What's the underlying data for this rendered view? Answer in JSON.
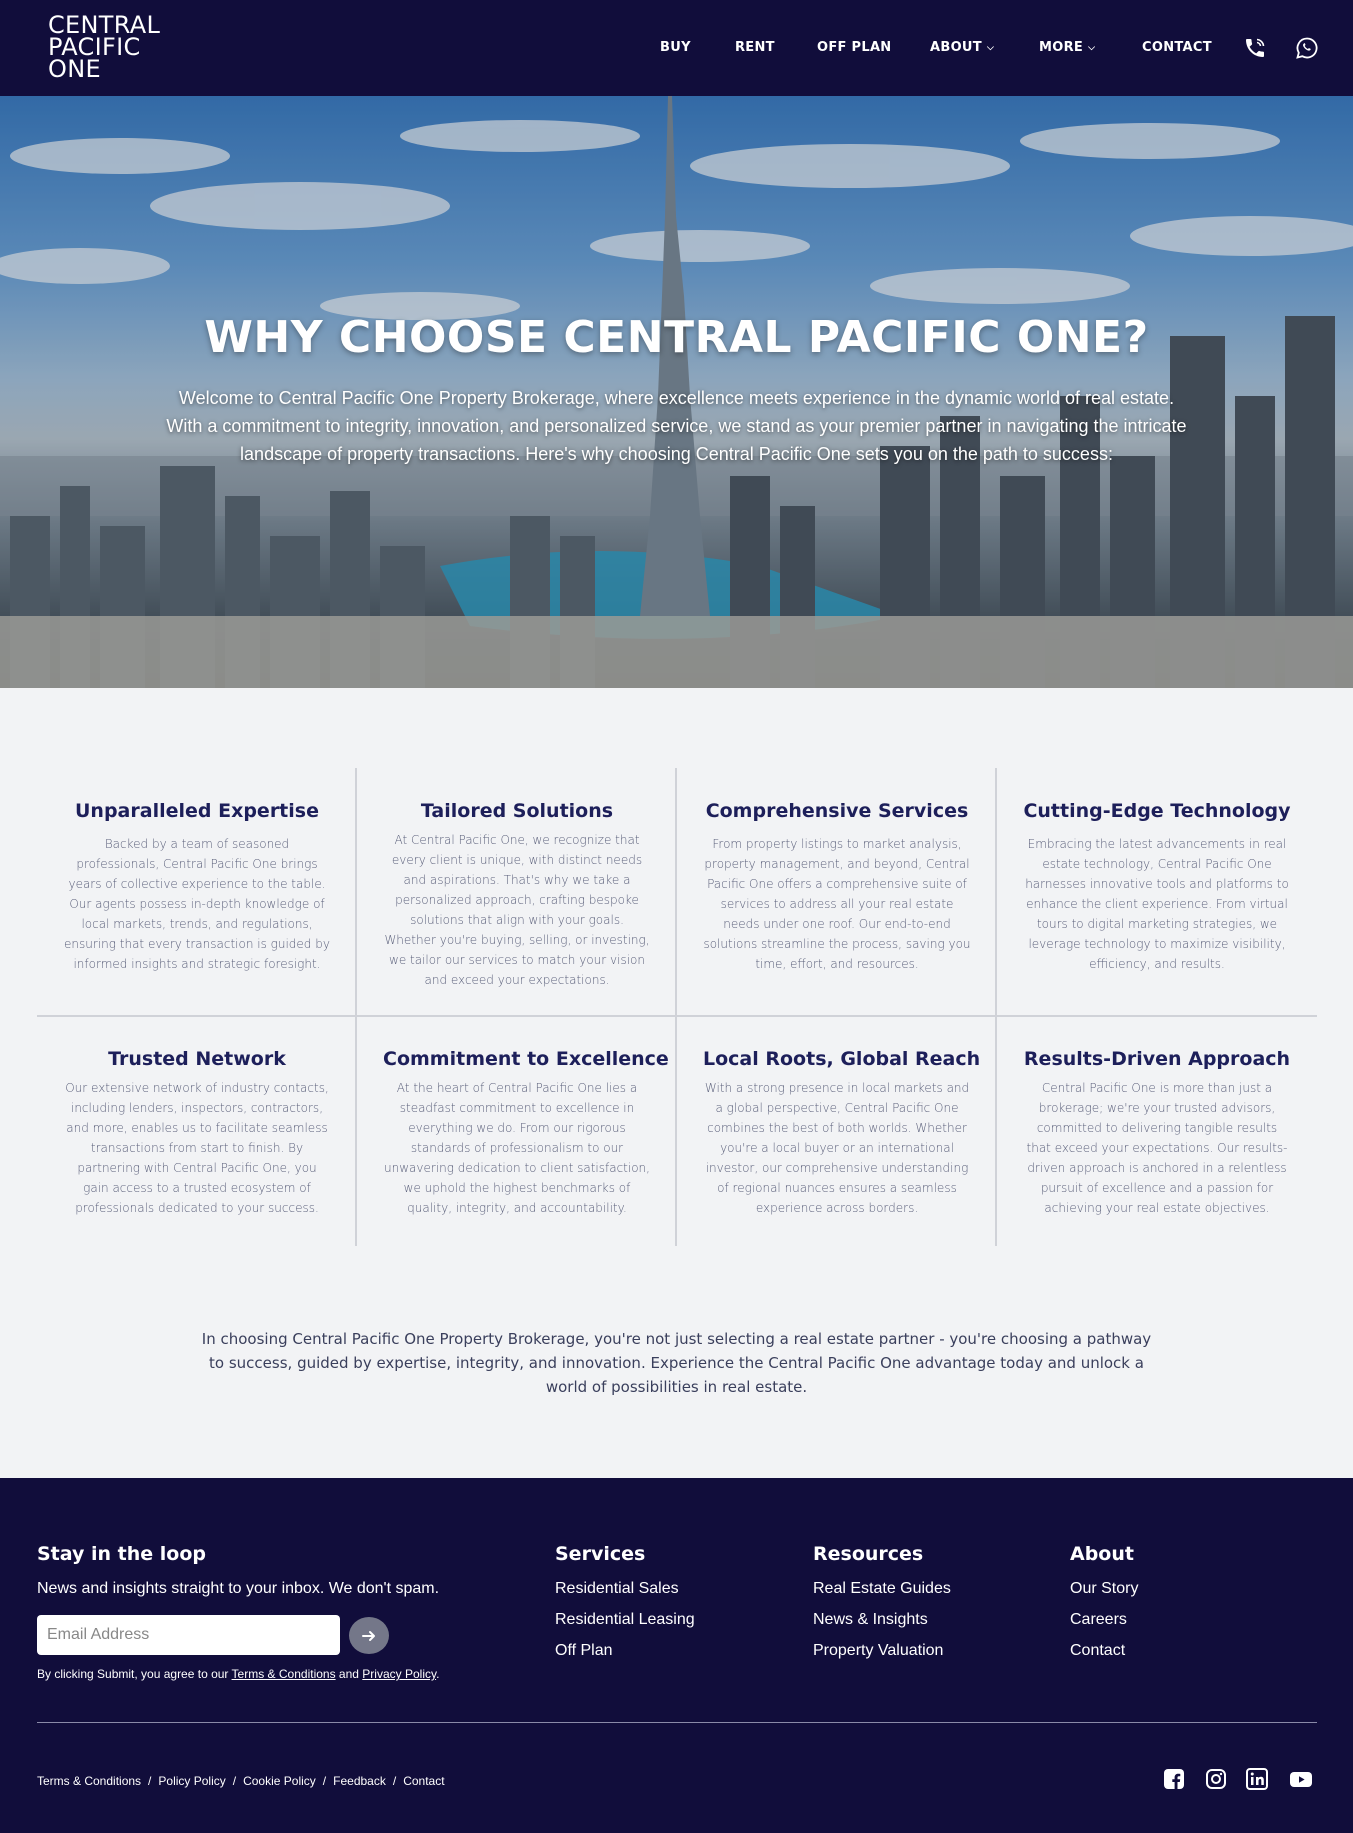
{
  "header": {
    "logo": [
      "CENTRAL",
      "PACIFIC",
      "ONE"
    ],
    "nav": [
      {
        "label": "BUY"
      },
      {
        "label": "RENT"
      },
      {
        "label": "OFF PLAN"
      },
      {
        "label": "ABOUT"
      },
      {
        "label": "MORE"
      },
      {
        "label": "CONTACT"
      }
    ],
    "icons": [
      "phone-icon",
      "whatsapp-icon",
      "chevron-down-icon"
    ]
  },
  "hero": {
    "title": "WHY CHOOSE CENTRAL PACIFIC ONE?",
    "text": "Welcome to Central Pacific One Property Brokerage, where excellence meets experience in the dynamic world of real estate. With a commitment to integrity, innovation, and personalized service, we stand as your premier partner in navigating the intricate landscape of property transactions. Here's why choosing Central Pacific One sets you on the path to success:"
  },
  "features": [
    {
      "title": "Unparalleled Expertise",
      "text": "Backed by a team of seasoned professionals, Central Pacific One brings years of collective experience to the table. Our agents possess in-depth knowledge of local markets, trends, and regulations, ensuring that every transaction is guided by informed insights and strategic foresight."
    },
    {
      "title": "Tailored Solutions",
      "text": "At Central Pacific One, we recognize that every client is unique, with distinct needs and aspirations. That's why we take a personalized approach, crafting bespoke solutions that align with your goals. Whether you're buying, selling, or investing, we tailor our services to match your vision and exceed your expectations."
    },
    {
      "title": "Comprehensive Services",
      "text": "From property listings to market analysis, property management, and beyond, Central Pacific One offers a comprehensive suite of services to address all your real estate needs under one roof. Our end-to-end solutions streamline the process, saving you time, effort, and resources."
    },
    {
      "title": "Cutting-Edge Technology",
      "text": "Embracing the latest advancements in real estate technology, Central Pacific One harnesses innovative tools and platforms to enhance the client experience. From virtual tours to digital marketing strategies, we leverage technology to maximize visibility, efficiency, and results."
    },
    {
      "title": "Trusted Network",
      "text": "Our extensive network of industry contacts, including lenders, inspectors, contractors, and more, enables us to facilitate seamless transactions from start to finish. By partnering with Central Pacific One, you gain access to a trusted ecosystem of professionals dedicated to your success."
    },
    {
      "title": "Commitment to Excellence",
      "text": "At the heart of Central Pacific One lies a steadfast commitment to excellence in everything we do. From our rigorous standards of professionalism to our unwavering dedication to client satisfaction, we uphold the highest benchmarks of quality, integrity, and accountability."
    },
    {
      "title": "Local Roots, Global Reach",
      "text": "With a strong presence in local markets and a global perspective, Central Pacific One combines the best of both worlds. Whether you're a local buyer or an international investor, our comprehensive understanding of regional nuances ensures a seamless experience across borders."
    },
    {
      "title": "Results-Driven Approach",
      "text": "Central Pacific One is more than just a brokerage; we're your trusted advisors, committed to delivering tangible results that exceed your expectations. Our results-driven approach is anchored in a relentless pursuit of excellence and a passion for achieving your real estate objectives."
    }
  ],
  "closing": "In choosing Central Pacific One Property Brokerage, you're not just selecting a real estate partner - you're choosing a pathway to success, guided by expertise, integrity, and innovation. Experience the Central Pacific One advantage today and unlock a world of possibilities in real estate.",
  "footer": {
    "newsletter": {
      "title": "Stay in the loop",
      "subtitle": "News and insights straight to your inbox. We don't spam.",
      "placeholder": "Email Address",
      "agree_prefix": "By clicking Submit, you agree to our ",
      "terms": "Terms & Conditions",
      "and": " and ",
      "privacy": "Privacy Policy",
      "period": "."
    },
    "services": {
      "title": "Services",
      "links": [
        "Residential Sales",
        "Residential Leasing",
        "Off Plan"
      ]
    },
    "resources": {
      "title": "Resources",
      "links": [
        "Real Estate Guides",
        "News & Insights",
        "Property Valuation"
      ]
    },
    "about": {
      "title": "About",
      "links": [
        "Our Story",
        "Careers",
        "Contact"
      ]
    },
    "legal": [
      "Terms & Conditions",
      "Policy Policy",
      "Cookie Policy",
      "Feedback",
      "Contact"
    ],
    "legal_sep": "/",
    "social": [
      "facebook-icon",
      "instagram-icon",
      "linkedin-icon",
      "youtube-icon"
    ]
  }
}
